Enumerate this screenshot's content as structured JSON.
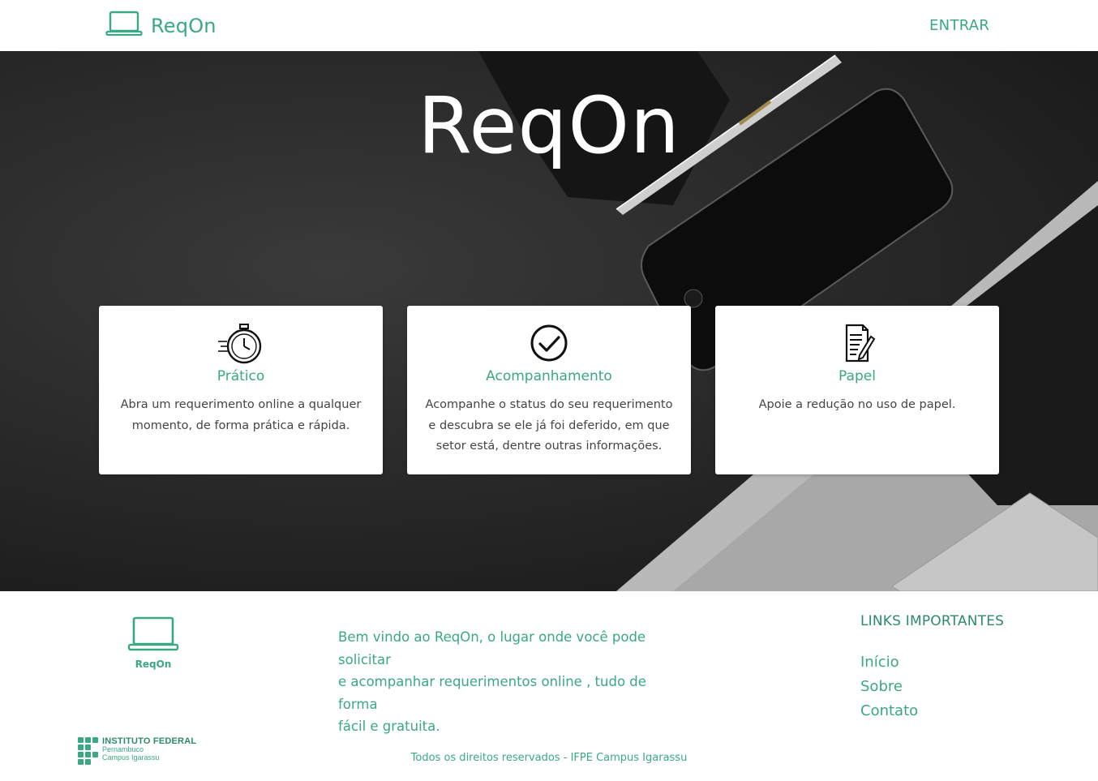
{
  "colors": {
    "accent": "#3aa981",
    "accent_dark": "#2e8b6a",
    "hero_bg": "#262626",
    "card_text": "#444444"
  },
  "navbar": {
    "brand_icon": "laptop-icon",
    "brand_name": "ReqOn",
    "login_label": "ENTRAR"
  },
  "hero": {
    "title": "ReqOn"
  },
  "features": [
    {
      "icon": "stopwatch-icon",
      "title": "Prático",
      "line1": "Abra um requerimento online a qualquer",
      "line2": "momento, de forma prática e rápida.",
      "line3": ""
    },
    {
      "icon": "check-circle-icon",
      "title": "Acompanhamento",
      "line1": "Acompanhe o status do seu requerimento",
      "line2": "e descubra se ele já foi deferido, em que",
      "line3": "setor está, dentre outras informações."
    },
    {
      "icon": "document-pen-icon",
      "title": "Papel",
      "line1": "Apoie a redução no uso de papel.",
      "line2": "",
      "line3": ""
    }
  ],
  "footer": {
    "logo_label": "ReqOn",
    "desc_line1": "Bem vindo ao ReqOn, o lugar onde você pode solicitar",
    "desc_line2": "e acompanhar requerimentos online , tudo de forma",
    "desc_line3": "fácil e gratuita.",
    "links_heading": "LINKS IMPORTANTES",
    "links": [
      "Início",
      "Sobre",
      "Contato"
    ],
    "institution_title": "INSTITUTO FEDERAL",
    "institution_line2": "Pernambuco",
    "institution_line3": "Campus Igarassu",
    "copyright": "Todos os direitos reservados - IFPE Campus Igarassu"
  }
}
